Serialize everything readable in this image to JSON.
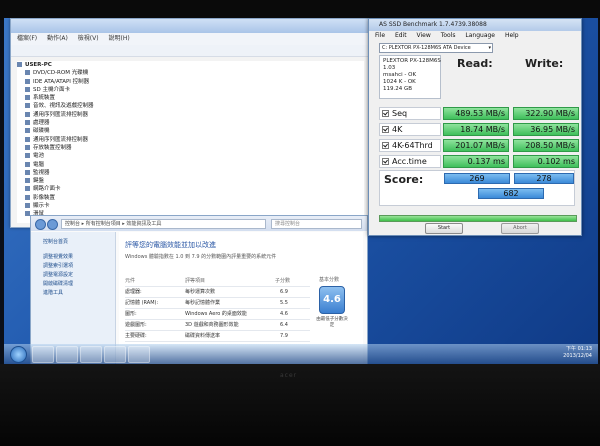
{
  "devmgr": {
    "menu": [
      "檔案(F)",
      "動作(A)",
      "檢視(V)",
      "說明(H)"
    ],
    "root": "USER-PC",
    "items": [
      "DVD/CD-ROM 光碟機",
      "IDE ATA/ATAPI 控制器",
      "SD 主機介面卡",
      "系統裝置",
      "音效、視訊及遊戲控制器",
      "通用序列匯流排控制器",
      "處理器",
      "磁碟機",
      "通用序列匯流排控制器",
      "存放裝置控制器",
      "電池",
      "電腦",
      "監視器",
      "鍵盤",
      "網路介面卡",
      "影像裝置",
      "顯示卡",
      "滑鼠"
    ]
  },
  "perf": {
    "path": "控制台 ▸ 所有控制台項目 ▸ 效能資訊及工具",
    "search": "搜尋控制台",
    "side": [
      "控制台首頁",
      "調整視覺效果",
      "調整索引選項",
      "調整電源設定",
      "開啟磁碟清理",
      "進階工具"
    ],
    "heading": "評等您的電腦效能並加以改進",
    "desc": "Windows 體驗指數在 1.0 到 7.9 的分數範圍內評量重要的系統元件",
    "table_headers": [
      "元件",
      "評等項目",
      "子分數",
      "基本分數"
    ],
    "rows": [
      {
        "component": "處理器:",
        "item": "每秒運算次數",
        "score": "6.9"
      },
      {
        "component": "記憶體 (RAM):",
        "item": "每秒記憶體作業",
        "score": "5.5"
      },
      {
        "component": "圖形:",
        "item": "Windows Aero 的桌面效能",
        "score": "4.6"
      },
      {
        "component": "遊戲圖形:",
        "item": "3D 遊戲和商務圖形效能",
        "score": "6.4"
      },
      {
        "component": "主要硬碟:",
        "item": "磁碟資料傳送率",
        "score": "7.9"
      }
    ],
    "base_score": "4.6",
    "base_caption": "由最低子分數決定"
  },
  "asssd": {
    "title": "AS SSD Benchmark 1.7.4739.38088",
    "menu": [
      "File",
      "Edit",
      "View",
      "Tools",
      "Language",
      "Help"
    ],
    "drive": "C: PLEXTOR PX-128M6S ATA Device",
    "info": [
      "PLEXTOR PX-128M6S",
      "1.03",
      "msahci - OK",
      "1024 K - OK",
      "119.24 GB"
    ],
    "read_header": "Read:",
    "write_header": "Write:",
    "tests": [
      {
        "label": "Seq",
        "read": "489.53 MB/s",
        "write": "322.90 MB/s"
      },
      {
        "label": "4K",
        "read": "18.74 MB/s",
        "write": "36.95 MB/s"
      },
      {
        "label": "4K-64Thrd",
        "read": "201.07 MB/s",
        "write": "208.50 MB/s"
      },
      {
        "label": "Acc.time",
        "read": "0.137 ms",
        "write": "0.102 ms"
      }
    ],
    "score_label": "Score:",
    "score_read": "269",
    "score_write": "278",
    "score_total": "682",
    "progress_fraction": 1.0,
    "start_label": "Start",
    "abort_label": "Abort"
  },
  "tray": {
    "time": "下午 01:13",
    "date": "2013/12/04"
  },
  "brand": "acer",
  "colors": {
    "result_green": "#3fbf5b",
    "score_blue": "#3b8ad8",
    "accent_blue": "#2a57a5"
  }
}
